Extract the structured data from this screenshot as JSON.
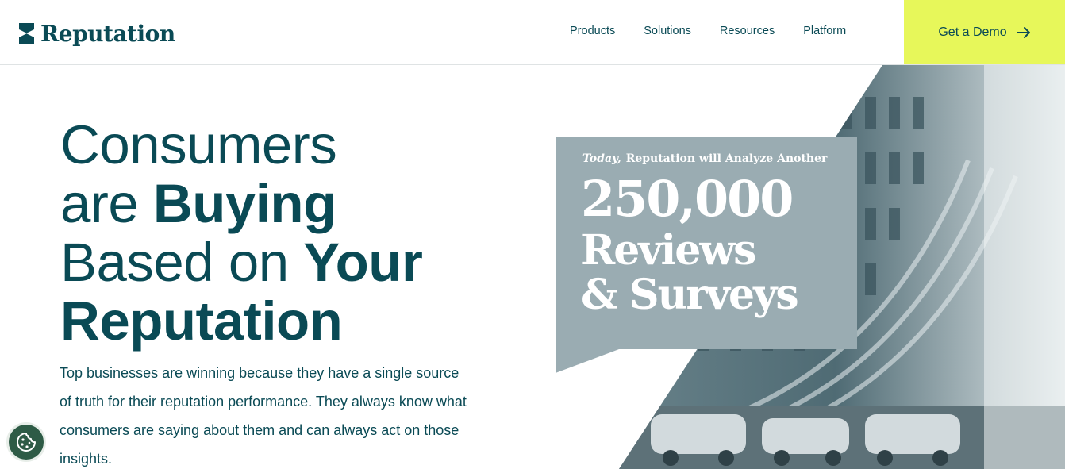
{
  "header": {
    "brand": "Reputation",
    "nav": [
      "Products",
      "Solutions",
      "Resources",
      "Platform"
    ],
    "cta_label": "Get a Demo"
  },
  "hero": {
    "headline": {
      "line1": "Consumers",
      "line2_light": "are ",
      "line2_bold": "Buying",
      "line3_light": "Based on ",
      "line3_bold": "Your",
      "line4_bold": "Reputation"
    },
    "body": "Top businesses are winning because they have a single source of truth for their reputation performance. They always know what consumers are saying about them and can always act on those insights."
  },
  "visual": {
    "subtitle_italic": "Today,",
    "subtitle": "Reputation will Analyze Another",
    "number": "250,000",
    "word1": "Reviews",
    "word2": "& Surveys",
    "colors": {
      "bubble": "#9aacb2",
      "accent": "#e7f75a",
      "brand": "#0a4a55"
    }
  },
  "icons": [
    "reputation-logo-icon",
    "arrow-right-icon",
    "cookie-icon"
  ]
}
